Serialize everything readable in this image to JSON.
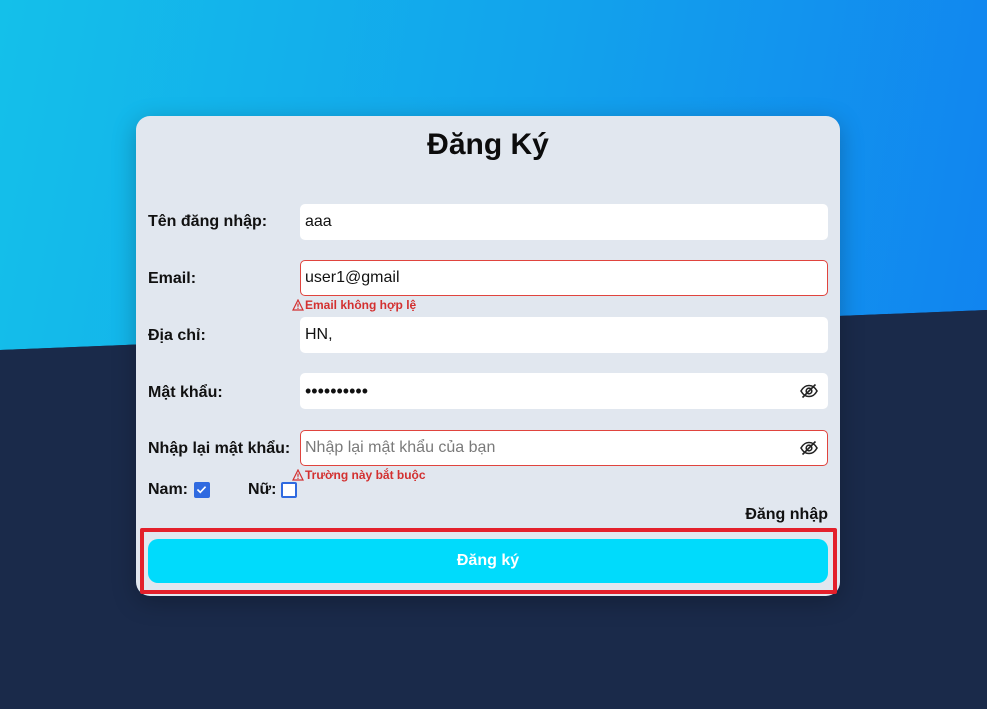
{
  "form": {
    "title": "Đăng Ký",
    "username": {
      "label": "Tên đăng nhập:",
      "value": "aaa"
    },
    "email": {
      "label": "Email:",
      "value": "user1@gmail",
      "error": "Email không hợp lệ"
    },
    "address": {
      "label": "Địa chỉ:",
      "value": "HN,"
    },
    "password": {
      "label": "Mật khẩu:",
      "value": "••••••••••"
    },
    "confirm_password": {
      "label": "Nhập lại mật khẩu:",
      "value": "",
      "placeholder": "Nhập lại mật khẩu của bạn",
      "error": "Trường này bắt buộc"
    },
    "gender": {
      "male": {
        "label": "Nam:",
        "checked": true
      },
      "female": {
        "label": "Nữ:",
        "checked": false
      }
    },
    "login_link": "Đăng nhập",
    "submit_label": "Đăng ký"
  },
  "icons": {
    "eye_off": "eye-off-icon",
    "warning": "warning-icon",
    "check": "check-icon"
  },
  "colors": {
    "card_bg": "#e1e7ef",
    "submit_bg": "#00dbfc",
    "error": "#d33030",
    "checkbox": "#2f6ae0",
    "highlight": "#e3202b"
  }
}
